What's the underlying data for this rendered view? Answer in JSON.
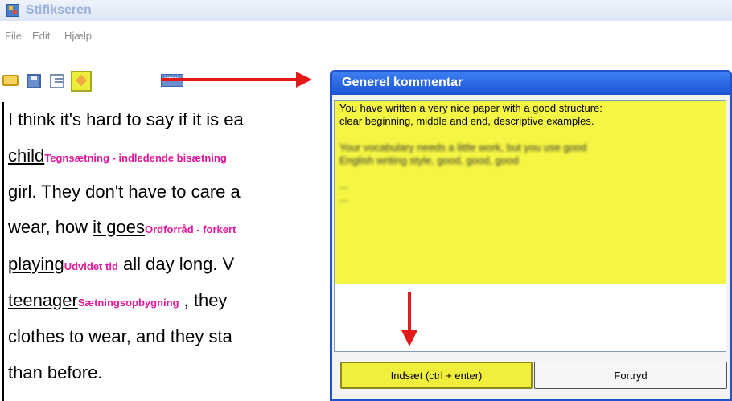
{
  "window": {
    "title": "Stifikseren"
  },
  "menu": [
    "File",
    "Edit",
    "Hjælp"
  ],
  "toolbar": {
    "html_label": "HTML",
    "icons": [
      "open-folder-icon",
      "save-icon",
      "edit-icon",
      "comment-icon",
      "html-icon"
    ]
  },
  "doc": {
    "lines": [
      {
        "text": "I think it's hard to say if it is ea"
      },
      {
        "word": "child",
        "tag": "Tegnsætning - indledende bisætning"
      },
      {
        "text": "girl. They don't have to care a"
      },
      {
        "pre": "wear, how ",
        "word": "it goes",
        "tag": "Ordforråd - forkert"
      },
      {
        "word": "playing",
        "tag": "Udvidet tid",
        "post": "  all day long. V"
      },
      {
        "word": "teenager",
        "tag": "Sætningsopbygning",
        "post": " , they"
      },
      {
        "text": "clothes to wear, and they sta"
      },
      {
        "text": "than before."
      }
    ]
  },
  "dialog": {
    "title": "Generel kommentar",
    "comment": {
      "line1": "You have written a very nice paper with a good structure:",
      "line2": "clear beginning, middle and end, descriptive examples.",
      "blur1": "Your vocabulary needs a little work, but you use good",
      "blur2": "English writing style, good, good, good",
      "blur3": "...",
      "blur4": "..."
    },
    "insert_label": "Indsæt (ctrl + enter)",
    "cancel_label": "Fortryd"
  },
  "colors": {
    "tag": "#e0189a",
    "dialog_title": "#1b55d6",
    "comment_bg": "#f5f543",
    "arrow": "#e21a1a"
  }
}
